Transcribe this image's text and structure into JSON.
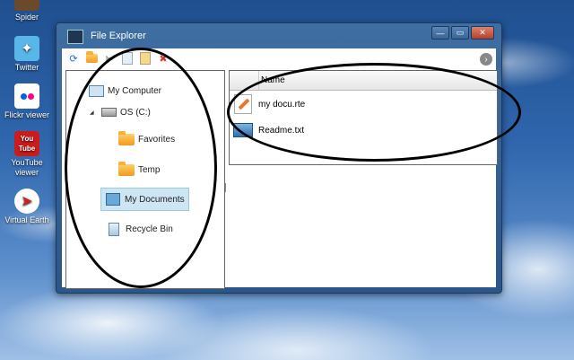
{
  "desktop": {
    "icons": [
      {
        "label": "Spider",
        "icon": "spider-solitaire-icon"
      },
      {
        "label": "Twitter",
        "icon": "twitter-bird-icon"
      },
      {
        "label": "Flickr viewer",
        "icon": "flickr-icon"
      },
      {
        "label_line1": "YouTube",
        "label_line2": "viewer",
        "icon": "youtube-icon"
      },
      {
        "label": "Virtual Earth",
        "icon": "compass-icon"
      }
    ]
  },
  "window": {
    "title": "File Explorer",
    "buttons": {
      "minimize": "—",
      "maximize": "▭",
      "close": "✕"
    }
  },
  "toolbar": {
    "icons": [
      "refresh-icon",
      "new-folder-icon",
      "cut-icon",
      "copy-icon",
      "paste-icon",
      "delete-icon"
    ],
    "nav_arrow": "›"
  },
  "tree": {
    "my_computer": "My Computer",
    "drive": "OS (C:)",
    "expander": "◢",
    "favorites": "Favorites",
    "temp": "Temp",
    "my_documents": "My Documents",
    "recycle_bin": "Recycle Bin"
  },
  "list": {
    "column_name": "Name",
    "items": [
      {
        "name": "my docu.rte",
        "icon": "pencil-document-icon"
      },
      {
        "name": "Readme.txt",
        "icon": "text-document-icon"
      }
    ]
  },
  "colors": {
    "selection": "#cde6f4",
    "folder": "#f29a1c",
    "titlebar": "#2a568a"
  }
}
